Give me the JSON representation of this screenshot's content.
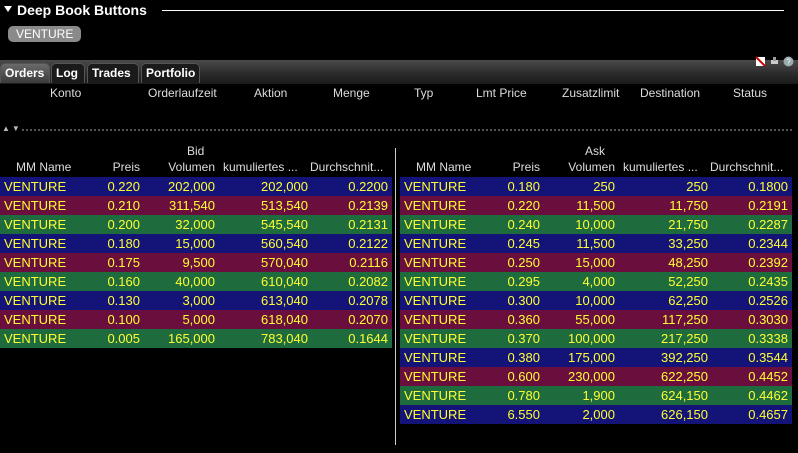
{
  "window": {
    "title": "Deep Book Buttons"
  },
  "symbol_chip": "VENTURE",
  "tabs": [
    {
      "label": "Orders",
      "active": true
    },
    {
      "label": "Log",
      "active": false
    },
    {
      "label": "Trades",
      "active": false
    },
    {
      "label": "Portfolio",
      "active": false
    }
  ],
  "orders_columns": [
    "Konto",
    "Orderlaufzeit",
    "Aktion",
    "Menge",
    "Typ",
    "Lmt Price",
    "Zusatzlimit",
    "Destination",
    "Status"
  ],
  "bid": {
    "title": "Bid",
    "headers": [
      "MM Name",
      "Preis",
      "Volumen",
      "kumuliertes ...",
      "Durchschnit..."
    ],
    "rows": [
      {
        "name": "VENTURE",
        "price": "0.220",
        "volume": "202,000",
        "cum": "202,000",
        "avg": "0.2200",
        "color": "#141478"
      },
      {
        "name": "VENTURE",
        "price": "0.210",
        "volume": "311,540",
        "cum": "513,540",
        "avg": "0.2139",
        "color": "#6a0e3e"
      },
      {
        "name": "VENTURE",
        "price": "0.200",
        "volume": "32,000",
        "cum": "545,540",
        "avg": "0.2131",
        "color": "#1e6b3d"
      },
      {
        "name": "VENTURE",
        "price": "0.180",
        "volume": "15,000",
        "cum": "560,540",
        "avg": "0.2122",
        "color": "#141478"
      },
      {
        "name": "VENTURE",
        "price": "0.175",
        "volume": "9,500",
        "cum": "570,040",
        "avg": "0.2116",
        "color": "#6a0e3e"
      },
      {
        "name": "VENTURE",
        "price": "0.160",
        "volume": "40,000",
        "cum": "610,040",
        "avg": "0.2082",
        "color": "#1e6b3d"
      },
      {
        "name": "VENTURE",
        "price": "0.130",
        "volume": "3,000",
        "cum": "613,040",
        "avg": "0.2078",
        "color": "#141478"
      },
      {
        "name": "VENTURE",
        "price": "0.100",
        "volume": "5,000",
        "cum": "618,040",
        "avg": "0.2070",
        "color": "#6a0e3e"
      },
      {
        "name": "VENTURE",
        "price": "0.005",
        "volume": "165,000",
        "cum": "783,040",
        "avg": "0.1644",
        "color": "#1e6b3d"
      }
    ]
  },
  "ask": {
    "title": "Ask",
    "headers": [
      "MM Name",
      "Preis",
      "Volumen",
      "kumuliertes ...",
      "Durchschnit..."
    ],
    "rows": [
      {
        "name": "VENTURE",
        "price": "0.180",
        "volume": "250",
        "cum": "250",
        "avg": "0.1800",
        "color": "#141478"
      },
      {
        "name": "VENTURE",
        "price": "0.220",
        "volume": "11,500",
        "cum": "11,750",
        "avg": "0.2191",
        "color": "#6a0e3e"
      },
      {
        "name": "VENTURE",
        "price": "0.240",
        "volume": "10,000",
        "cum": "21,750",
        "avg": "0.2287",
        "color": "#1e6b3d"
      },
      {
        "name": "VENTURE",
        "price": "0.245",
        "volume": "11,500",
        "cum": "33,250",
        "avg": "0.2344",
        "color": "#141478"
      },
      {
        "name": "VENTURE",
        "price": "0.250",
        "volume": "15,000",
        "cum": "48,250",
        "avg": "0.2392",
        "color": "#6a0e3e"
      },
      {
        "name": "VENTURE",
        "price": "0.295",
        "volume": "4,000",
        "cum": "52,250",
        "avg": "0.2435",
        "color": "#1e6b3d"
      },
      {
        "name": "VENTURE",
        "price": "0.300",
        "volume": "10,000",
        "cum": "62,250",
        "avg": "0.2526",
        "color": "#141478"
      },
      {
        "name": "VENTURE",
        "price": "0.360",
        "volume": "55,000",
        "cum": "117,250",
        "avg": "0.3030",
        "color": "#6a0e3e"
      },
      {
        "name": "VENTURE",
        "price": "0.370",
        "volume": "100,000",
        "cum": "217,250",
        "avg": "0.3338",
        "color": "#1e6b3d"
      },
      {
        "name": "VENTURE",
        "price": "0.380",
        "volume": "175,000",
        "cum": "392,250",
        "avg": "0.3544",
        "color": "#141478"
      },
      {
        "name": "VENTURE",
        "price": "0.600",
        "volume": "230,000",
        "cum": "622,250",
        "avg": "0.4452",
        "color": "#6a0e3e"
      },
      {
        "name": "VENTURE",
        "price": "0.780",
        "volume": "1,900",
        "cum": "624,150",
        "avg": "0.4462",
        "color": "#1e6b3d"
      },
      {
        "name": "VENTURE",
        "price": "6.550",
        "volume": "2,000",
        "cum": "626,150",
        "avg": "0.4657",
        "color": "#141478"
      }
    ]
  },
  "icons": [
    "collapse-triangle-icon",
    "clear-icon",
    "tools-icon",
    "help-icon",
    "sort-up-icon",
    "sort-down-icon"
  ],
  "colors": {
    "text_yellow": "#ffff33",
    "background": "#000000",
    "row_blue": "#141478",
    "row_maroon": "#6a0e3e",
    "row_green": "#1e6b3d"
  }
}
